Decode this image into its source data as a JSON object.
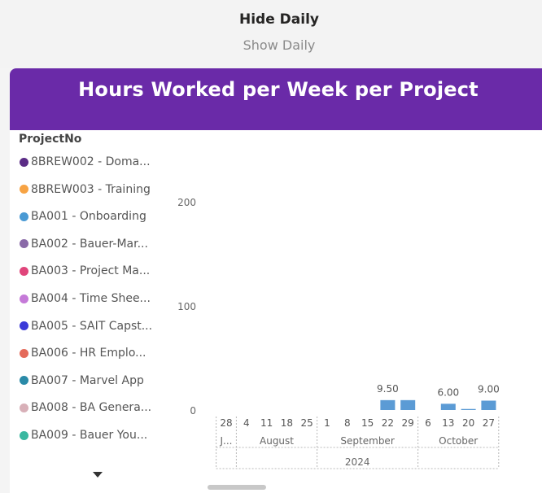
{
  "toggle": {
    "hide_label": "Hide Daily",
    "show_label": "Show Daily"
  },
  "chart_data": {
    "type": "bar",
    "title": "Hours Worked per Week per Project",
    "legend_title": "ProjectNo",
    "legend_position": "left",
    "grid": false,
    "ylim": [
      0,
      200
    ],
    "y_ticks": [
      "200",
      "100",
      "0"
    ],
    "series_names": [
      "8BREW002 - Doma...",
      "8BREW003 - Training",
      "BA001 - Onboarding",
      "BA002 - Bauer-Mar...",
      "BA003 - Project Ma...",
      "BA004 - Time Shee...",
      "BA005 - SAIT Capst...",
      "BA006 - HR Emplo...",
      "BA007 - Marvel App",
      "BA008 - BA Genera...",
      "BA009 - Bauer You..."
    ],
    "series_colors": [
      "#5b2c86",
      "#f7a343",
      "#4a9ad4",
      "#8a6aa8",
      "#e0457b",
      "#c57ad8",
      "#3b3ad8",
      "#e46a5a",
      "#2a8aa8",
      "#d8b0b8",
      "#3ab8a0"
    ],
    "x": [
      "28",
      "4",
      "11",
      "18",
      "25",
      "1",
      "8",
      "15",
      "22",
      "29",
      "6",
      "13",
      "20",
      "27"
    ],
    "month_labels": [
      "J...",
      "August",
      "September",
      "October"
    ],
    "year_label": "2024",
    "values": [
      0,
      0,
      0,
      0,
      0,
      0,
      0,
      0,
      9.5,
      9.5,
      0,
      6,
      1,
      9
    ],
    "data_labels": [
      {
        "index": 8,
        "text": "9.50"
      },
      {
        "index": 11,
        "text": "6.00"
      },
      {
        "index": 13,
        "text": "9.00"
      }
    ],
    "bar_color": "#5b9bd5"
  }
}
